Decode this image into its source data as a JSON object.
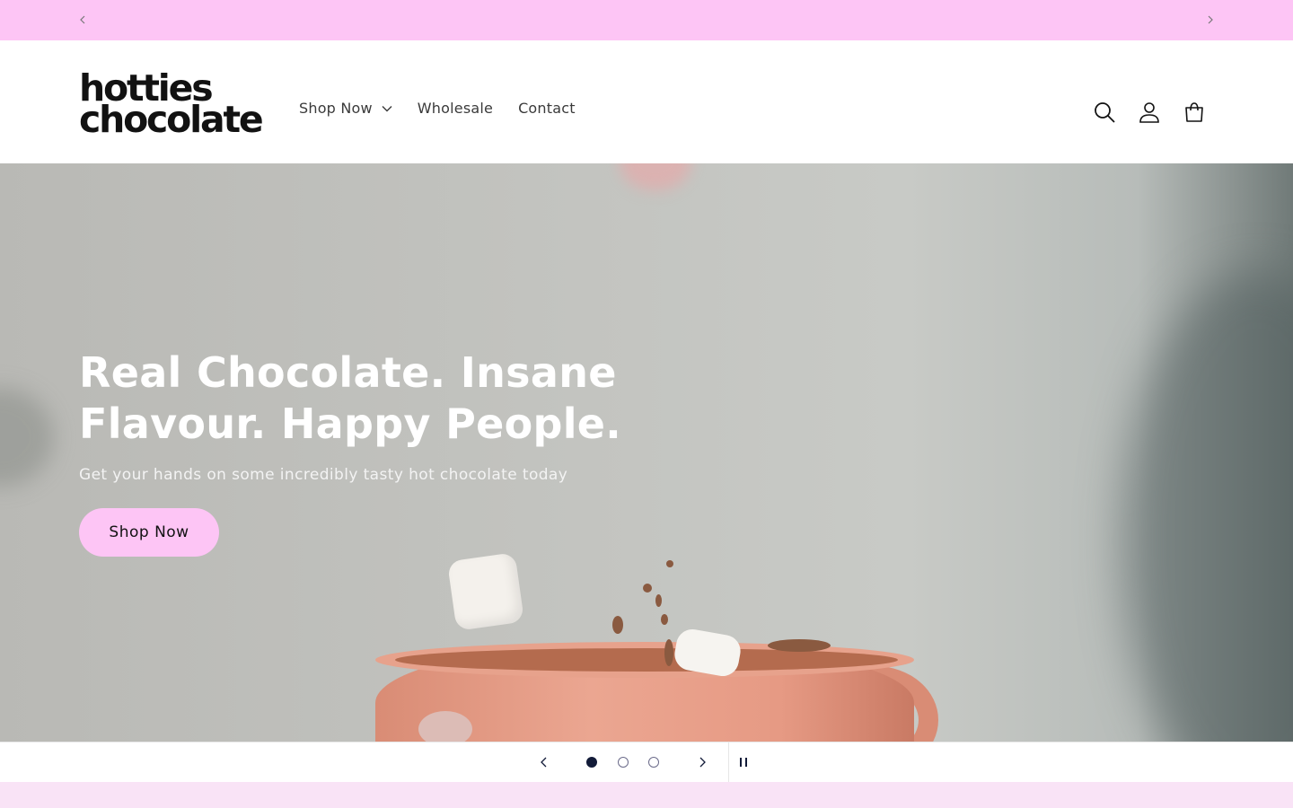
{
  "announcement": {
    "prev_icon": "chevron-left-icon",
    "next_icon": "chevron-right-icon",
    "background": "#fdc5f5"
  },
  "header": {
    "logo_line1": "hotties",
    "logo_line2": "chocolate",
    "nav": [
      {
        "label": "Shop Now",
        "has_dropdown": true
      },
      {
        "label": "Wholesale"
      },
      {
        "label": "Contact"
      }
    ],
    "icons": [
      "search-icon",
      "account-icon",
      "cart-icon"
    ]
  },
  "hero": {
    "title": "Real Chocolate. Insane Flavour. Happy People.",
    "subtitle": "Get your hands on some incredibly tasty hot chocolate today",
    "button_label": "Shop Now",
    "button_color": "#fdc5f5"
  },
  "slideshow": {
    "slide_count": 3,
    "active_slide": 1,
    "dot_color": "#121b38",
    "icons": [
      "chevron-left-icon",
      "chevron-right-icon",
      "pause-icon"
    ]
  },
  "colors": {
    "accent": "#fdc5f5",
    "bottom_band": "#f9e3f6",
    "text": "#121212"
  }
}
